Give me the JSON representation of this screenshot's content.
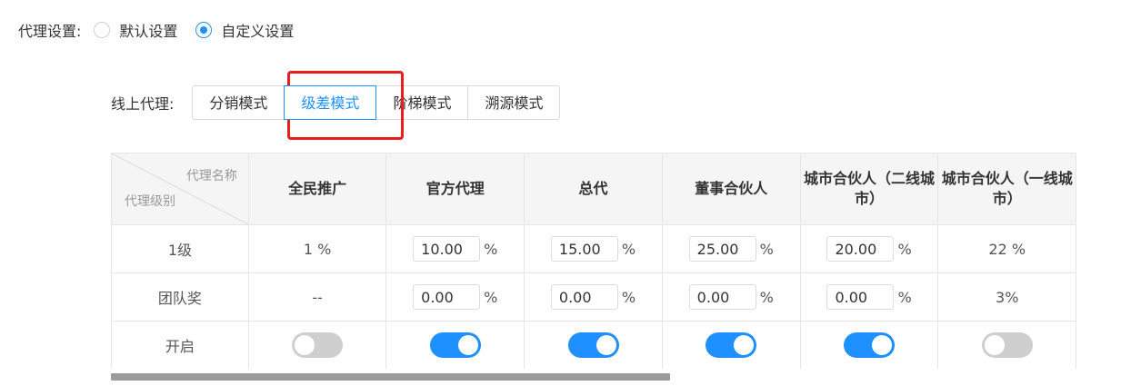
{
  "agent_setting": {
    "label": "代理设置:",
    "options": [
      {
        "label": "默认设置",
        "checked": false
      },
      {
        "label": "自定义设置",
        "checked": true
      }
    ]
  },
  "online_agent": {
    "label": "线上代理:",
    "modes": [
      {
        "label": "分销模式",
        "active": false
      },
      {
        "label": "级差模式",
        "active": true
      },
      {
        "label": "阶梯模式",
        "active": false
      },
      {
        "label": "溯源模式",
        "active": false
      }
    ]
  },
  "table": {
    "corner_top": "代理名称",
    "corner_bottom": "代理级别",
    "headers": [
      "全民推广",
      "官方代理",
      "总代",
      "董事合伙人",
      "城市合伙人（二线城市）",
      "城市合伙人（一线城市）"
    ],
    "rows": {
      "level1": {
        "label": "1级",
        "cells": [
          {
            "type": "text",
            "value": "1 %"
          },
          {
            "type": "input",
            "value": "10.00",
            "unit": "%"
          },
          {
            "type": "input",
            "value": "15.00",
            "unit": "%"
          },
          {
            "type": "input",
            "value": "25.00",
            "unit": "%"
          },
          {
            "type": "input",
            "value": "20.00",
            "unit": "%"
          },
          {
            "type": "text",
            "value": "22 %"
          }
        ]
      },
      "team_bonus": {
        "label": "团队奖",
        "cells": [
          {
            "type": "text",
            "value": "--"
          },
          {
            "type": "input",
            "value": "0.00",
            "unit": "%"
          },
          {
            "type": "input",
            "value": "0.00",
            "unit": "%"
          },
          {
            "type": "input",
            "value": "0.00",
            "unit": "%"
          },
          {
            "type": "input",
            "value": "0.00",
            "unit": "%"
          },
          {
            "type": "text",
            "value": "3%"
          }
        ]
      },
      "enabled": {
        "label": "开启",
        "switches": [
          false,
          true,
          true,
          true,
          true,
          false
        ]
      }
    }
  },
  "colors": {
    "accent": "#1e90ff",
    "highlight": "#e81e1e",
    "switch_off": "#cfcfcf"
  }
}
